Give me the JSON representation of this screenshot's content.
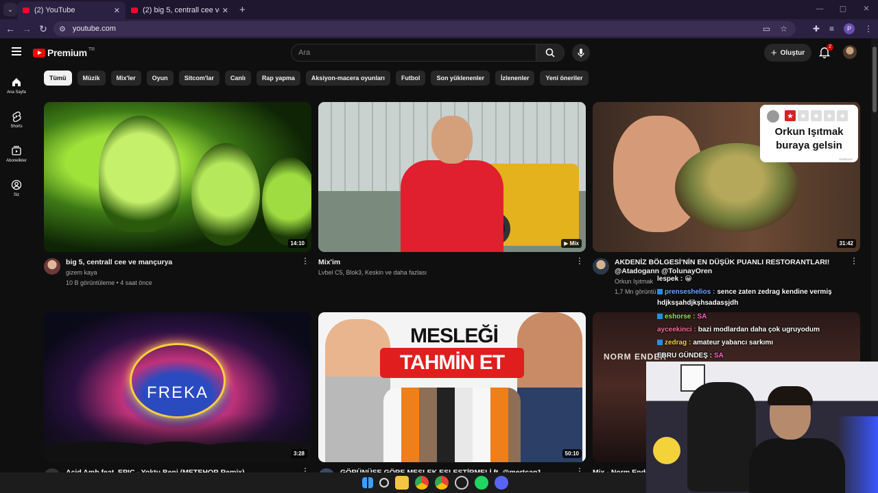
{
  "browser": {
    "tabs": [
      {
        "title": "(2) YouTube",
        "active": true
      },
      {
        "title": "(2) big 5, centrall cee ve mançurya",
        "active": false
      }
    ],
    "url": "youtube.com",
    "profile_initial": "P"
  },
  "youtube": {
    "logo_text": "Premium",
    "country_code": "TR",
    "search_placeholder": "Ara",
    "create_label": "Oluştur",
    "notification_count": "2",
    "sidebar": [
      {
        "label": "Ana Sayfa",
        "icon": "home-icon"
      },
      {
        "label": "Shorts",
        "icon": "shorts-icon"
      },
      {
        "label": "Abonelikler",
        "icon": "subscriptions-icon"
      },
      {
        "label": "Siz",
        "icon": "you-icon"
      }
    ],
    "chips": [
      "Tümü",
      "Müzik",
      "Mix'ler",
      "Oyun",
      "Sitcom'lar",
      "Canlı",
      "Rap yapma",
      "Aksiyon-macera oyunları",
      "Futbol",
      "Son yüklenenler",
      "İzlenenler",
      "Yeni öneriler"
    ],
    "videos": [
      {
        "title": "big 5, centrall cee ve mançurya",
        "channel": "gizem kaya",
        "stats": "10 B görüntüleme • 4 saat önce",
        "duration": "14:10"
      },
      {
        "title": "Mix'im",
        "channel": "Lvbel C5, Blok3, Keskin ve daha fazlası",
        "stats": "",
        "duration": "Mix"
      },
      {
        "title": "AKDENİZ BÖLGESİ'NİN EN DÜŞÜK PUANLI RESTORANTLARI! @Atadogann @TolunayOren",
        "channel": "Orkun Işıtmak",
        "stats": "1,7 Mn görüntü",
        "duration": "31:42",
        "overlay_text": "Orkun Işıtmak buraya gelsin",
        "overlay_date": "2025/01/01"
      },
      {
        "title": "Acid Amb feat. EPIC - Yoktu Beni (METEHOR Remix)",
        "channel": "",
        "stats": "",
        "duration": "3:28",
        "overlay_text": "FREKA"
      },
      {
        "title": "GÖRÜNÜŞE GÖRE MESLEK EŞLEŞTİRMELİ ft. @mertcan1",
        "channel": "",
        "stats": "",
        "duration": "50:10",
        "overlay_line1": "MESLEĞİ",
        "overlay_line2": "TAHMİN ET"
      },
      {
        "title": "Mix - Norm Ender",
        "channel": "",
        "stats": "",
        "duration": "",
        "overlay_text": "NORM ENDER"
      }
    ]
  },
  "stream_chat": [
    {
      "user": "lespek :",
      "message": "",
      "color": "#ffffff"
    },
    {
      "user": "prenseshelios :",
      "message": "sence zaten zedrag kendine vermiş hdjksşahdjkşhsadasşjdh",
      "color": "#6ea8ff"
    },
    {
      "user": "eshorse :",
      "message": "SA",
      "color": "#9be35b"
    },
    {
      "user": "ayceekinci :",
      "message": "bazi modlardan daha çok ugruyodum",
      "color": "#ff6b9b"
    },
    {
      "user": "zedrag :",
      "message": "amateur yabancı sarkımı",
      "color": "#ffd23f"
    },
    {
      "user": "EBRU GÜNDEŞ :",
      "message": "SA",
      "color": "#ffffff"
    }
  ]
}
